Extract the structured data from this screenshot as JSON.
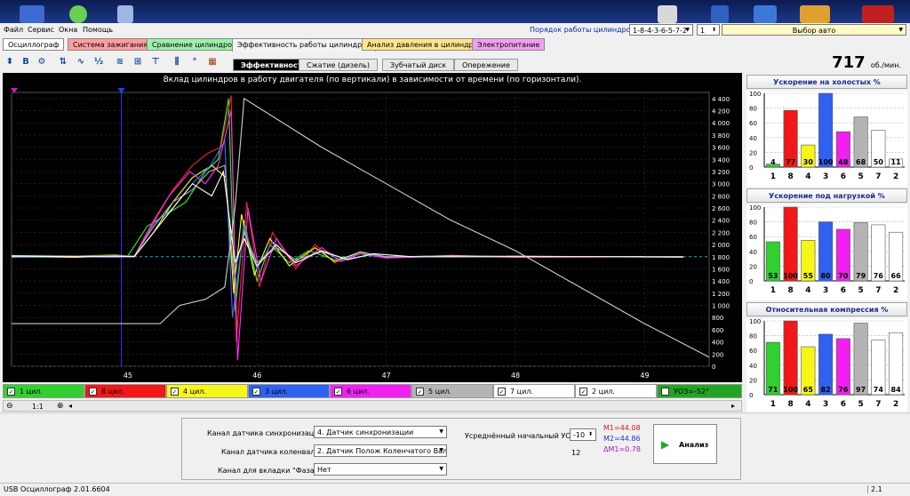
{
  "menu": {
    "items": [
      "Файл",
      "Сервис",
      "Окна",
      "Помощь"
    ]
  },
  "topbar": {
    "firing_order_label": "Порядок работы цилиндров",
    "firing_order_value": "1-8-4-3-6-5-7-2",
    "stepper_value": "1",
    "car_select_label": "Выбор авто"
  },
  "tabs": [
    {
      "label": "Осциллограф",
      "color": "#ffffff"
    },
    {
      "label": "Система зажигания",
      "color": "#ff9e9e"
    },
    {
      "label": "Сравнение цилиндров",
      "color": "#9ef0a8"
    },
    {
      "label": "Эффективность работы цилиндров",
      "color": "#f4f4f4"
    },
    {
      "label": "Анализ давления в цилиндре",
      "color": "#ffe58a"
    },
    {
      "label": "Электропитание",
      "color": "#f0a0f0"
    }
  ],
  "subtabs": [
    "Эффективность",
    "Сжатие (дизель)",
    "Зубчатый диск",
    "Опережение"
  ],
  "rpm": {
    "value": "717",
    "unit": "об./мин."
  },
  "chart_data": {
    "type": "line",
    "title": "Вклад цилиндров в работу двигателя (по вертикали) в зависимости от времени (по горизонтали).",
    "x_ticks": [
      "45",
      "46",
      "47",
      "48",
      "49"
    ],
    "y_ticks": [
      "4 400",
      "4 200",
      "4 000",
      "3 800",
      "3 600",
      "3 400",
      "3 200",
      "3 000",
      "2 800",
      "2 600",
      "2 400",
      "2 200",
      "2 000",
      "1 800",
      "1 600",
      "1 400",
      "1 200",
      "1 000",
      "800",
      "600",
      "400",
      "200",
      "0"
    ],
    "xlim": [
      44.1,
      49.5
    ],
    "ylim": [
      0,
      4500
    ],
    "series": [
      {
        "color": "#1eff1e",
        "points": [
          [
            44.1,
            1820
          ],
          [
            44.6,
            1810
          ],
          [
            44.9,
            1830
          ],
          [
            45.0,
            1810
          ],
          [
            45.15,
            2300
          ],
          [
            45.3,
            2500
          ],
          [
            45.45,
            2700
          ],
          [
            45.6,
            3200
          ],
          [
            45.7,
            3400
          ],
          [
            45.78,
            4400
          ],
          [
            45.83,
            900
          ],
          [
            45.9,
            2400
          ],
          [
            46.0,
            1400
          ],
          [
            46.1,
            2000
          ],
          [
            46.25,
            1700
          ],
          [
            46.4,
            1900
          ],
          [
            46.6,
            1750
          ],
          [
            46.8,
            1850
          ],
          [
            47.0,
            1800
          ],
          [
            47.5,
            1810
          ],
          [
            48.0,
            1800
          ],
          [
            49.0,
            1800
          ]
        ]
      },
      {
        "color": "#ff2020",
        "points": [
          [
            44.1,
            1810
          ],
          [
            44.6,
            1800
          ],
          [
            44.9,
            1820
          ],
          [
            45.05,
            1810
          ],
          [
            45.2,
            2400
          ],
          [
            45.35,
            2900
          ],
          [
            45.5,
            3300
          ],
          [
            45.62,
            3500
          ],
          [
            45.72,
            3600
          ],
          [
            45.8,
            4450
          ],
          [
            45.84,
            400
          ],
          [
            45.92,
            2700
          ],
          [
            46.02,
            1300
          ],
          [
            46.12,
            2200
          ],
          [
            46.3,
            1600
          ],
          [
            46.45,
            2000
          ],
          [
            46.6,
            1700
          ],
          [
            46.8,
            1850
          ],
          [
            47.0,
            1780
          ],
          [
            47.5,
            1820
          ],
          [
            48.0,
            1790
          ],
          [
            49.0,
            1800
          ]
        ]
      },
      {
        "color": "#ffff20",
        "points": [
          [
            44.1,
            1800
          ],
          [
            44.6,
            1790
          ],
          [
            44.9,
            1810
          ],
          [
            45.05,
            1800
          ],
          [
            45.2,
            2200
          ],
          [
            45.35,
            2700
          ],
          [
            45.5,
            3100
          ],
          [
            45.65,
            3300
          ],
          [
            45.76,
            3100
          ],
          [
            45.82,
            1200
          ],
          [
            45.88,
            2500
          ],
          [
            45.98,
            1500
          ],
          [
            46.1,
            2100
          ],
          [
            46.25,
            1650
          ],
          [
            46.45,
            1950
          ],
          [
            46.6,
            1720
          ],
          [
            46.8,
            1880
          ],
          [
            47.0,
            1790
          ],
          [
            47.5,
            1820
          ],
          [
            48.0,
            1800
          ],
          [
            49.0,
            1800
          ]
        ]
      },
      {
        "color": "#3a6bff",
        "points": [
          [
            44.1,
            1790
          ],
          [
            44.6,
            1800
          ],
          [
            44.9,
            1790
          ],
          [
            45.05,
            1800
          ],
          [
            45.2,
            2350
          ],
          [
            45.35,
            2600
          ],
          [
            45.5,
            3000
          ],
          [
            45.64,
            3300
          ],
          [
            45.75,
            3700
          ],
          [
            45.81,
            800
          ],
          [
            45.9,
            2300
          ],
          [
            46.0,
            1600
          ],
          [
            46.12,
            2050
          ],
          [
            46.3,
            1700
          ],
          [
            46.5,
            1900
          ],
          [
            46.65,
            1740
          ],
          [
            46.8,
            1860
          ],
          [
            47.0,
            1800
          ],
          [
            47.5,
            1810
          ],
          [
            48.0,
            1800
          ],
          [
            49.0,
            1800
          ]
        ]
      },
      {
        "color": "#ff30ff",
        "points": [
          [
            44.1,
            1800
          ],
          [
            44.6,
            1810
          ],
          [
            44.9,
            1800
          ],
          [
            45.05,
            1800
          ],
          [
            45.18,
            2300
          ],
          [
            45.32,
            2800
          ],
          [
            45.48,
            3200
          ],
          [
            45.6,
            3000
          ],
          [
            45.7,
            3300
          ],
          [
            45.8,
            4200
          ],
          [
            45.85,
            100
          ],
          [
            45.93,
            2600
          ],
          [
            46.03,
            1400
          ],
          [
            46.15,
            2100
          ],
          [
            46.3,
            1650
          ],
          [
            46.5,
            1950
          ],
          [
            46.65,
            1720
          ],
          [
            46.8,
            1850
          ],
          [
            47.0,
            1780
          ],
          [
            47.5,
            1810
          ],
          [
            48.0,
            1800
          ],
          [
            49.0,
            1800
          ]
        ]
      },
      {
        "color": "#b0b0b0",
        "points": [
          [
            44.1,
            1800
          ],
          [
            44.6,
            1800
          ],
          [
            44.9,
            1800
          ],
          [
            45.05,
            1810
          ],
          [
            45.2,
            2300
          ],
          [
            45.35,
            2700
          ],
          [
            45.5,
            2900
          ],
          [
            45.63,
            3200
          ],
          [
            45.75,
            3300
          ],
          [
            45.82,
            1500
          ],
          [
            45.9,
            2200
          ],
          [
            46.0,
            1700
          ],
          [
            46.15,
            1950
          ],
          [
            46.3,
            1750
          ],
          [
            46.5,
            1880
          ],
          [
            46.7,
            1760
          ],
          [
            46.9,
            1840
          ],
          [
            47.0,
            1800
          ],
          [
            47.5,
            1800
          ],
          [
            48.0,
            1810
          ],
          [
            49.3,
            1790
          ]
        ]
      },
      {
        "color": "#ffffff",
        "points": [
          [
            44.1,
            1810
          ],
          [
            44.6,
            1800
          ],
          [
            44.9,
            1810
          ],
          [
            45.05,
            1800
          ],
          [
            45.2,
            2200
          ],
          [
            45.35,
            2600
          ],
          [
            45.5,
            3000
          ],
          [
            45.65,
            2800
          ],
          [
            45.74,
            3200
          ],
          [
            45.83,
            1700
          ],
          [
            45.9,
            2100
          ],
          [
            46.0,
            1650
          ],
          [
            46.15,
            2000
          ],
          [
            46.3,
            1700
          ],
          [
            46.5,
            1900
          ],
          [
            46.7,
            1750
          ],
          [
            46.9,
            1850
          ],
          [
            47.2,
            1800
          ],
          [
            48.0,
            1800
          ],
          [
            49.3,
            1800
          ]
        ]
      },
      {
        "color": "#cfcfcf",
        "points": [
          [
            44.1,
            700
          ],
          [
            44.55,
            700
          ],
          [
            45.0,
            700
          ],
          [
            45.25,
            700
          ],
          [
            45.4,
            1000
          ],
          [
            45.6,
            1100
          ],
          [
            45.75,
            1300
          ],
          [
            45.83,
            2600
          ],
          [
            45.9,
            4400
          ],
          [
            46.05,
            4200
          ],
          [
            46.5,
            3600
          ],
          [
            47.0,
            3000
          ],
          [
            47.5,
            2400
          ],
          [
            48.0,
            1900
          ],
          [
            48.5,
            1300
          ],
          [
            49.0,
            700
          ],
          [
            49.5,
            150
          ]
        ]
      }
    ],
    "markers": [
      "M1",
      "M2"
    ],
    "dashed_hline": 1800
  },
  "channels": [
    {
      "label": "1 цил.",
      "color": "#2fd02f",
      "checked": true
    },
    {
      "label": "8 цил.",
      "color": "#f01818",
      "checked": true
    },
    {
      "label": "4 цил.",
      "color": "#f6f618",
      "checked": true
    },
    {
      "label": "3 цил.",
      "color": "#3060f0",
      "checked": true
    },
    {
      "label": "6 цил.",
      "color": "#f020f0",
      "checked": true
    },
    {
      "label": "5 цил.",
      "color": "#b4b4b4",
      "checked": true
    },
    {
      "label": "7 цил.",
      "color": "#ffffff",
      "checked": true
    },
    {
      "label": "2 цил.",
      "color": "#ffffff",
      "checked": true
    },
    {
      "label": "УОЗ=-52°",
      "color": "#22a422",
      "checked": false
    }
  ],
  "zoom": {
    "label": "1:1"
  },
  "right_panels": [
    {
      "title": "Ускорение на холостых %",
      "categories": [
        "1",
        "8",
        "4",
        "3",
        "6",
        "5",
        "7",
        "2"
      ],
      "values": [
        4,
        77,
        30,
        100,
        48,
        68,
        50,
        11
      ],
      "colors": [
        "#2fd02f",
        "#f01818",
        "#f6f618",
        "#3060f0",
        "#f020f0",
        "#b4b4b4",
        "#ffffff",
        "#ffffff"
      ],
      "y_ticks": [
        "100",
        "80",
        "60",
        "40",
        "20",
        "0"
      ]
    },
    {
      "title": "Ускорение под нагрузкой %",
      "categories": [
        "1",
        "8",
        "4",
        "3",
        "6",
        "5",
        "7",
        "2"
      ],
      "values": [
        53,
        100,
        55,
        80,
        70,
        79,
        76,
        66
      ],
      "colors": [
        "#2fd02f",
        "#f01818",
        "#f6f618",
        "#3060f0",
        "#f020f0",
        "#b4b4b4",
        "#ffffff",
        "#ffffff"
      ],
      "y_ticks": [
        "100",
        "80",
        "60",
        "40",
        "20",
        "0"
      ]
    },
    {
      "title": "Относительная компрессия %",
      "categories": [
        "1",
        "8",
        "4",
        "3",
        "6",
        "5",
        "7",
        "2"
      ],
      "values": [
        71,
        100,
        65,
        82,
        76,
        97,
        74,
        84
      ],
      "colors": [
        "#2fd02f",
        "#f01818",
        "#f6f618",
        "#3060f0",
        "#f020f0",
        "#b4b4b4",
        "#ffffff",
        "#ffffff"
      ],
      "y_ticks": [
        "100",
        "80",
        "60",
        "40",
        "20",
        "0"
      ]
    }
  ],
  "bottom": {
    "sync_label": "Канал датчика синхронизации",
    "sync_value": "4. Датчик синхронизации",
    "crank_label": "Канал датчика коленвала",
    "crank_value": "2. Датчик Полож Коленчатого Вал",
    "phase_label": "Канал для вкладки \"Фаза\"",
    "phase_value": "Нет",
    "avg_label": "Усреднённый начальный УОЗ",
    "avg_value": "-10",
    "count": "12",
    "m1": "M1=44.08",
    "m2": "M2=44.86",
    "dm": "ΔM1=0.78",
    "analyze_label": "Анализ"
  },
  "status": {
    "app": "USB Осциллограф  2.01.6604",
    "right": "2.1"
  }
}
